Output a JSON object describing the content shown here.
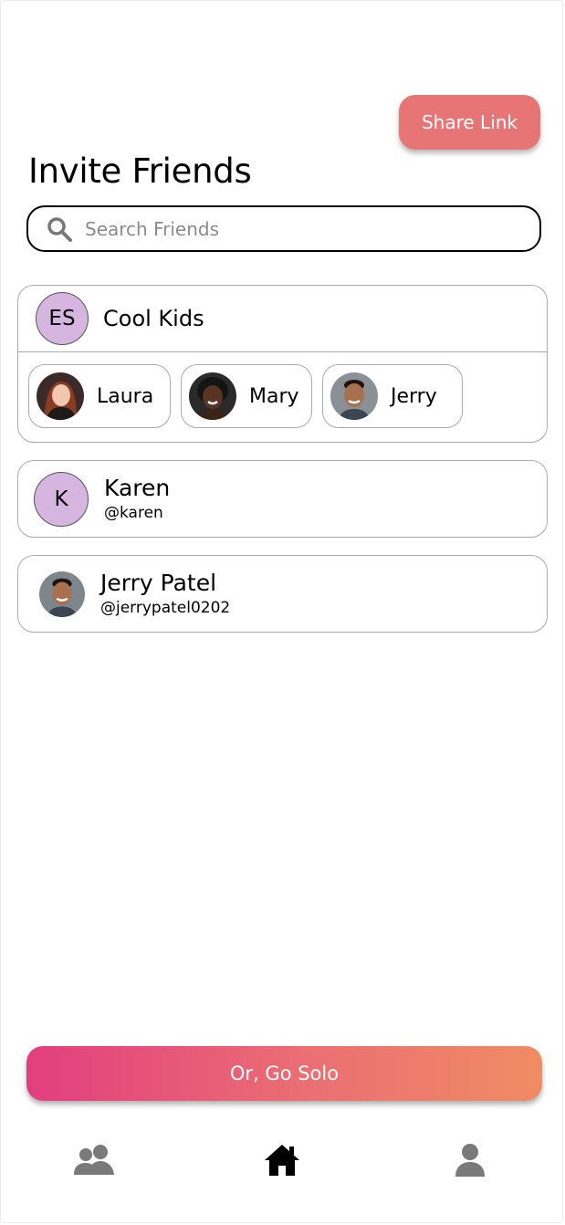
{
  "header": {
    "share_label": "Share Link",
    "title": "Invite Friends"
  },
  "search": {
    "placeholder": "Search Friends",
    "value": ""
  },
  "group": {
    "initials": "ES",
    "name": "Cool Kids",
    "members": [
      {
        "name": "Laura"
      },
      {
        "name": "Mary"
      },
      {
        "name": "Jerry"
      }
    ]
  },
  "friends": [
    {
      "initials": "K",
      "name": "Karen",
      "handle": "@karen"
    },
    {
      "name": "Jerry Patel",
      "handle": "@jerrypatel0202"
    }
  ],
  "solo_label": "Or, Go Solo",
  "nav": {
    "friends_icon": "friends-icon",
    "home_icon": "home-icon",
    "profile_icon": "profile-icon"
  },
  "colors": {
    "share": "#e87575",
    "avatar_bg": "#d6b6e0",
    "gradient_start": "#e23e7e",
    "gradient_end": "#f08c64"
  }
}
